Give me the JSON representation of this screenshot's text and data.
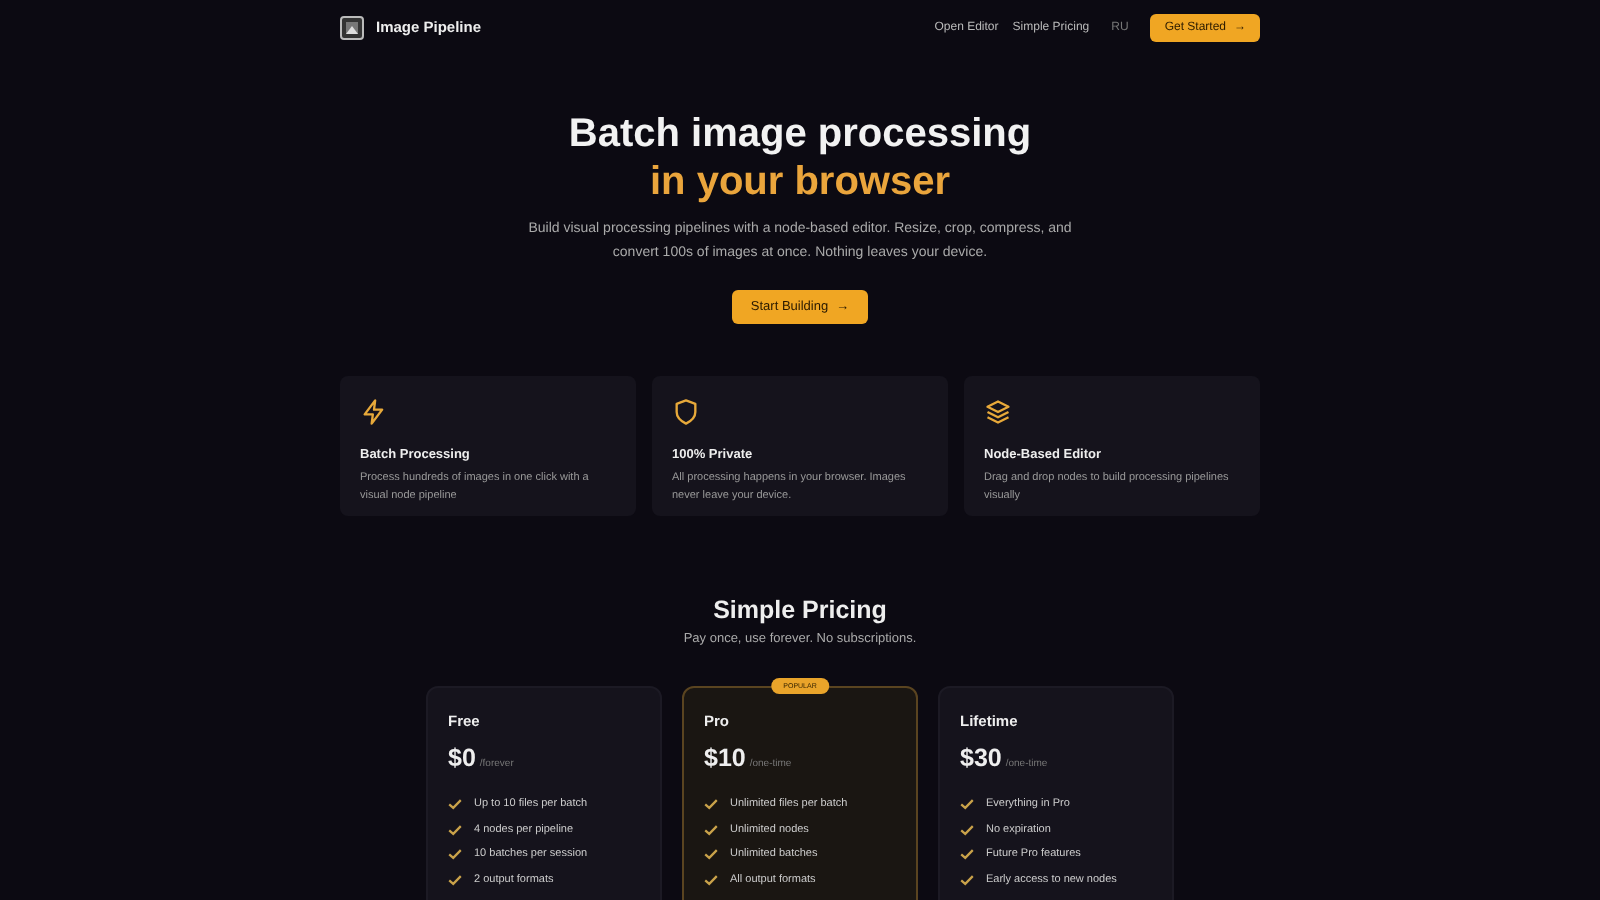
{
  "nav": {
    "brand": "Image Pipeline",
    "links": [
      "Open Editor",
      "Simple Pricing",
      "RU"
    ],
    "cta": "Get Started",
    "cta_arrow": "→"
  },
  "hero": {
    "title": "Batch image processing",
    "title_accent": "in your browser",
    "subtitle": "Build visual processing pipelines with a node-based editor. Resize, crop, compress, and convert 100s of images at once. Nothing leaves your device.",
    "button": "Start Building",
    "button_arrow": "→"
  },
  "features": [
    {
      "kind": "bolt",
      "title": "Batch Processing",
      "text": "Process hundreds of images in one click with a visual node pipeline"
    },
    {
      "kind": "shield",
      "title": "100% Private",
      "text": "All processing happens in your browser. Images never leave your device."
    },
    {
      "kind": "layers",
      "title": "Node-Based Editor",
      "text": "Drag and drop nodes to build processing pipelines visually"
    }
  ],
  "pricing": {
    "title": "Simple Pricing",
    "subtitle": "Pay once, use forever. No subscriptions.",
    "plans": [
      {
        "name": "Free",
        "price": "$0",
        "period": "/forever",
        "featured": false,
        "features": [
          "Up to 10 files per batch",
          "4 nodes per pipeline",
          "10 batches per session",
          "2 output formats"
        ]
      },
      {
        "name": "Pro",
        "price": "$10",
        "period": "/one-time",
        "featured": true,
        "badge": "POPULAR",
        "features": [
          "Unlimited files per batch",
          "Unlimited nodes",
          "Unlimited batches",
          "All output formats"
        ]
      },
      {
        "name": "Lifetime",
        "price": "$30",
        "period": "/one-time",
        "featured": false,
        "features": [
          "Everything in Pro",
          "No expiration",
          "Future Pro features",
          "Early access to new nodes"
        ]
      }
    ]
  }
}
